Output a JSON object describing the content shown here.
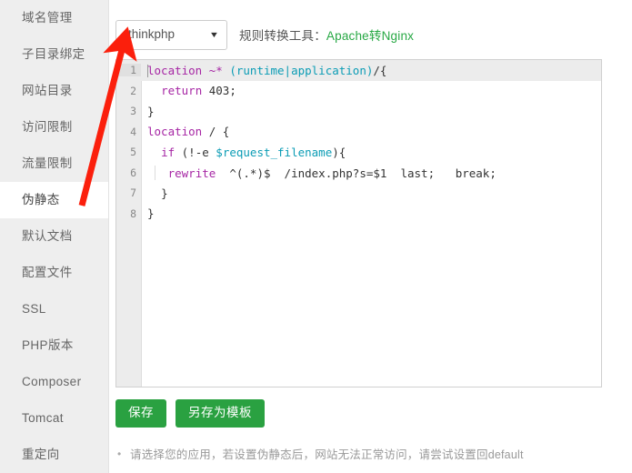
{
  "sidebar": {
    "items": [
      {
        "label": "域名管理",
        "active": false
      },
      {
        "label": "子目录绑定",
        "active": false
      },
      {
        "label": "网站目录",
        "active": false
      },
      {
        "label": "访问限制",
        "active": false
      },
      {
        "label": "流量限制",
        "active": false
      },
      {
        "label": "伪静态",
        "active": true
      },
      {
        "label": "默认文档",
        "active": false
      },
      {
        "label": "配置文件",
        "active": false
      },
      {
        "label": "SSL",
        "active": false
      },
      {
        "label": "PHP版本",
        "active": false
      },
      {
        "label": "Composer",
        "active": false
      },
      {
        "label": "Tomcat",
        "active": false
      },
      {
        "label": "重定向",
        "active": false
      }
    ]
  },
  "toolbar": {
    "select": {
      "value": "thinkphp",
      "caret_icon": "chevron-down-icon"
    },
    "tool_label": "规则转换工具：",
    "tool_link": "Apache转Nginx"
  },
  "editor": {
    "active_line": 1,
    "lines": [
      {
        "no": "1",
        "text": "location ~* (runtime|application)/{"
      },
      {
        "no": "2",
        "text": "  return 403;"
      },
      {
        "no": "3",
        "text": "}"
      },
      {
        "no": "4",
        "text": "location / {"
      },
      {
        "no": "5",
        "text": "  if (!-e $request_filename){"
      },
      {
        "no": "6",
        "text": "    rewrite  ^(.*)$  /index.php?s=$1  last;   break;"
      },
      {
        "no": "7",
        "text": "  }"
      },
      {
        "no": "8",
        "text": "}"
      }
    ]
  },
  "buttons": {
    "save": "保存",
    "save_as_template": "另存为模板"
  },
  "notes": [
    "请选择您的应用，若设置伪静态后，网站无法正常访问，请尝试设置回default"
  ],
  "annotation": {
    "arrow_icon": "red-arrow-annotation"
  },
  "colors": {
    "accent_green": "#2aa141",
    "link_green": "#27a844",
    "sidebar_bg": "#eeeeee",
    "annotation_red": "#fb1f0c",
    "keyword_purple": "#a626a4",
    "variable_cyan": "#0b9cb5"
  }
}
